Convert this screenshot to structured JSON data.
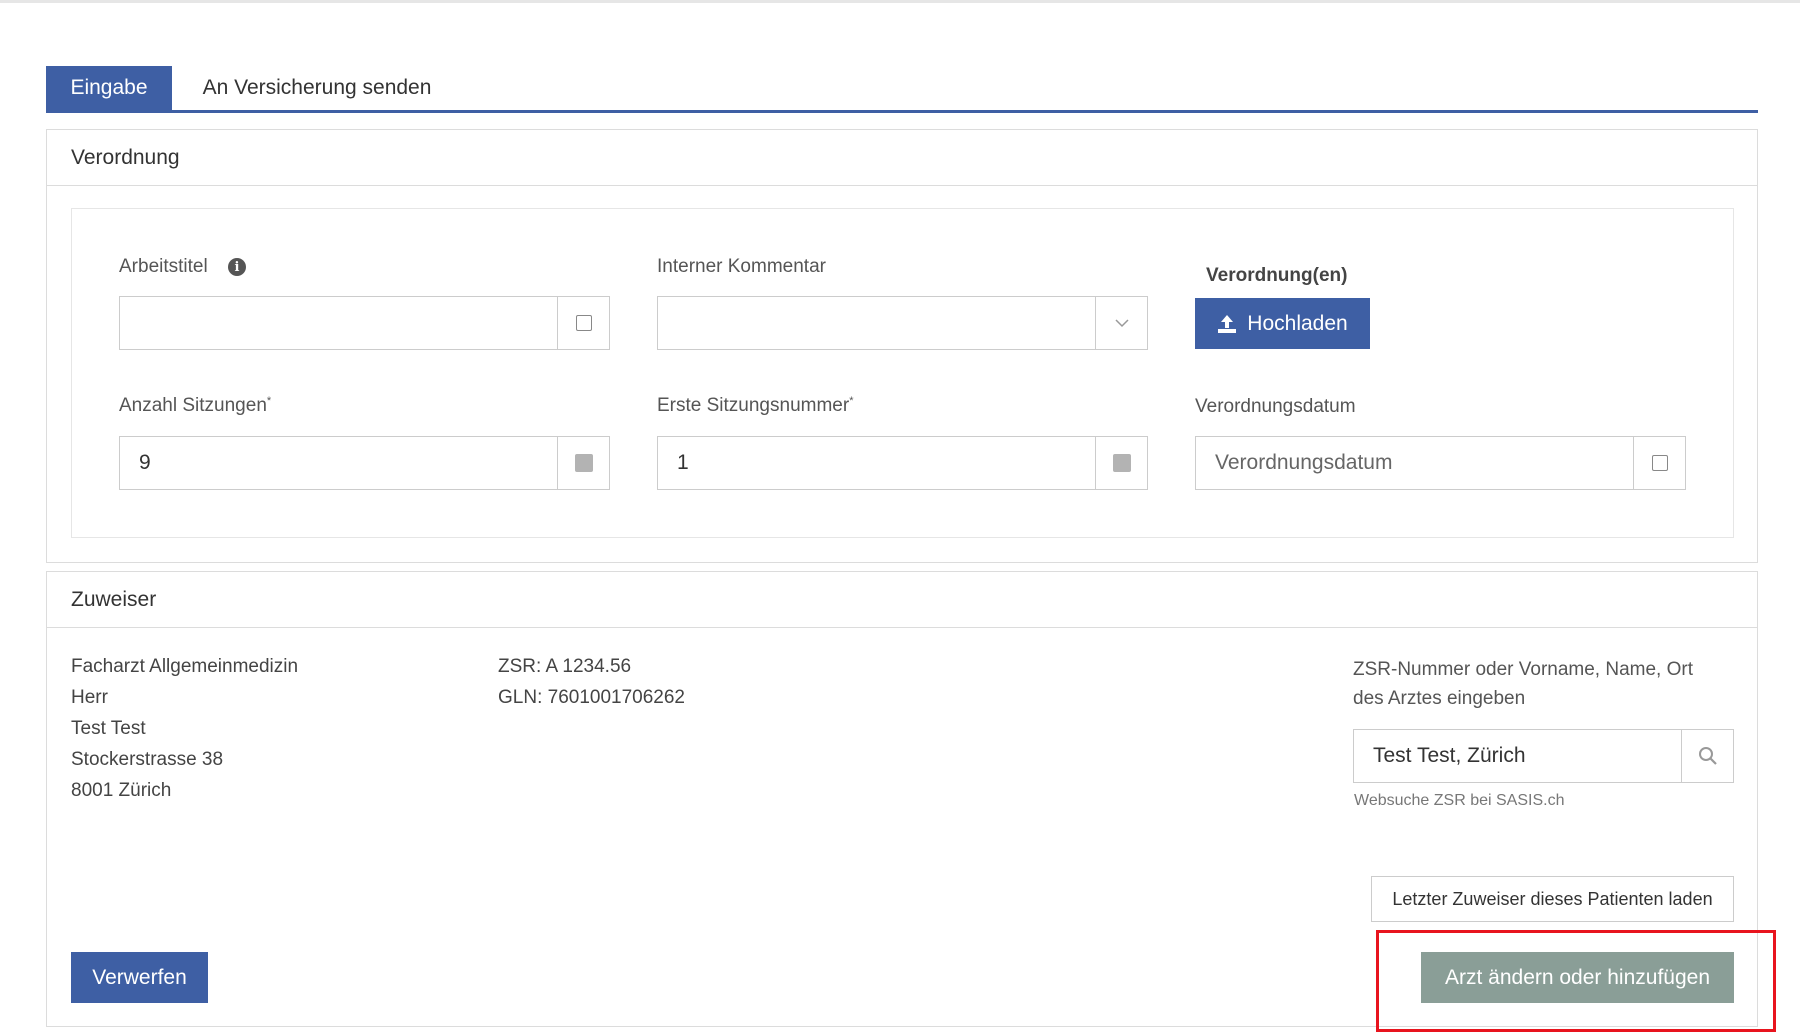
{
  "tabs": [
    {
      "label": "Eingabe",
      "active": true
    },
    {
      "label": "An Versicherung senden",
      "active": false
    }
  ],
  "verordnung": {
    "title": "Verordnung",
    "arbeitstitel_label": "Arbeitstitel",
    "arbeitstitel_value": "",
    "interner_kommentar_label": "Interner Kommentar",
    "interner_kommentar_value": "",
    "upload_section_label": "Verordnung(en)",
    "upload_button": "Hochladen",
    "anzahl_sitzungen_label": "Anzahl Sitzungen",
    "anzahl_sitzungen_value": "9",
    "erste_sitzungsnummer_label": "Erste Sitzungsnummer",
    "erste_sitzungsnummer_value": "1",
    "required_marker": "*",
    "verordnungsdatum_label": "Verordnungsdatum",
    "verordnungsdatum_placeholder": "Verordnungsdatum"
  },
  "zuweiser": {
    "title": "Zuweiser",
    "address_lines": [
      "Facharzt Allgemeinmedizin",
      "Herr",
      "Test Test",
      "Stockerstrasse 38",
      "8001 Zürich"
    ],
    "zsr": "ZSR: A 1234.56",
    "gln": "GLN: 7601001706262",
    "search_label_line1": "ZSR-Nummer oder Vorname, Name, Ort",
    "search_label_line2": "des Arztes eingeben",
    "search_value": "Test Test, Zürich",
    "websuche_link": "Websuche ZSR bei SASIS.ch",
    "load_last_button": "Letzter Zuweiser dieses Patienten laden",
    "discard_button": "Verwerfen",
    "change_doctor_button": "Arzt ändern oder hinzufügen"
  },
  "colors": {
    "primary": "#3e5fa4",
    "grey_button": "#8a9e97",
    "highlight": "#e8141e"
  }
}
